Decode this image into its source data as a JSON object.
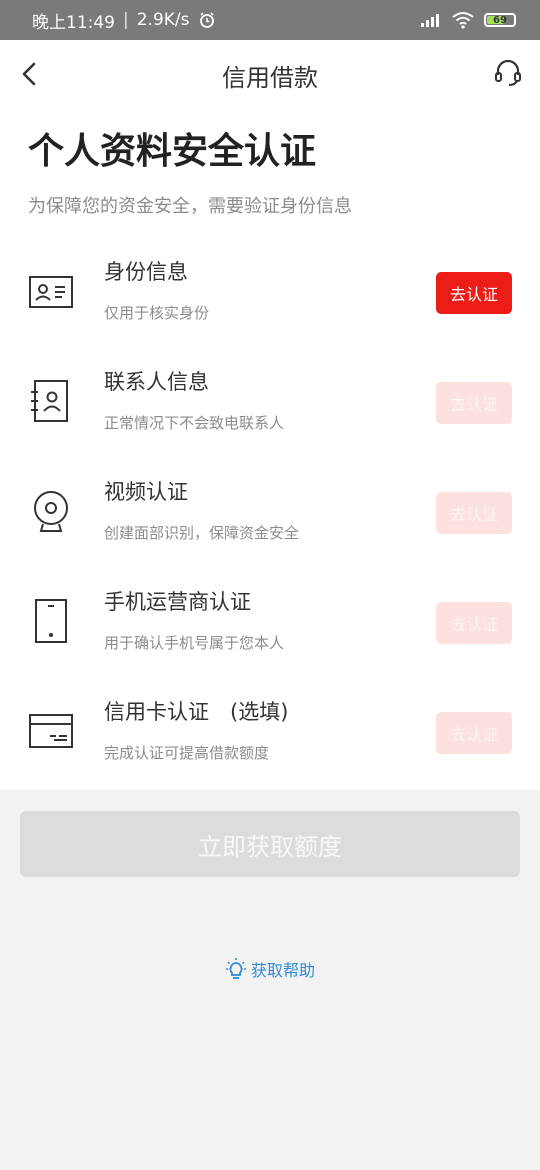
{
  "status_bar": {
    "time": "晚上11:49",
    "separator": "|",
    "speed": "2.9K/s",
    "battery": "69",
    "icons": [
      "alarm-icon",
      "signal-icon",
      "wifi-icon",
      "battery-icon"
    ]
  },
  "nav": {
    "title": "信用借款",
    "back_icon": "chevron-left-icon",
    "support_icon": "headset-icon"
  },
  "header": {
    "title": "个人资料安全认证",
    "subtitle": "为保障您的资金安全，需要验证身份信息"
  },
  "items": [
    {
      "title": "身份信息",
      "desc": "仅用于核实身份",
      "button": "去认证",
      "icon": "id-card-icon",
      "state": "active"
    },
    {
      "title": "联系人信息",
      "desc": "正常情况下不会致电联系人",
      "button": "去认证",
      "icon": "contact-book-icon",
      "state": "disabled"
    },
    {
      "title": "视频认证",
      "desc": "创建面部识别，保障资金安全",
      "button": "去认证",
      "icon": "webcam-icon",
      "state": "disabled"
    },
    {
      "title": "手机运营商认证",
      "desc": "用于确认手机号属于您本人",
      "button": "去认证",
      "icon": "phone-icon",
      "state": "disabled"
    },
    {
      "title": "信用卡认证　(选填)",
      "desc": "完成认证可提高借款额度",
      "button": "去认证",
      "icon": "credit-card-icon",
      "state": "disabled"
    }
  ],
  "cta": {
    "label": "立即获取额度"
  },
  "help": {
    "label": "获取帮助",
    "icon": "lightbulb-icon"
  },
  "colors": {
    "accent": "#ec1d17",
    "disabled_button": "#fde1df",
    "cta_disabled": "#dcdcdc",
    "link": "#2f8ad8"
  }
}
